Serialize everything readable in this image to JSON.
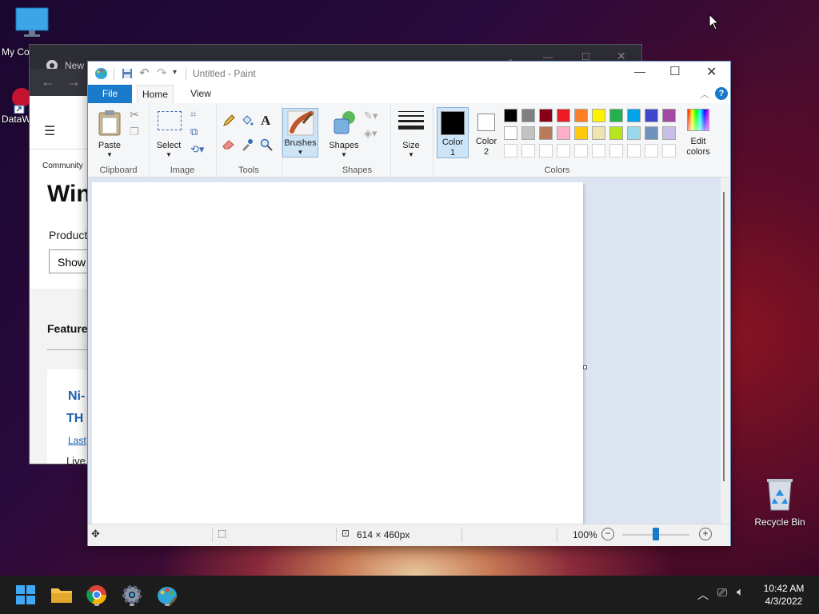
{
  "desktop": {
    "icons": [
      {
        "label": "My Co"
      },
      {
        "label": "DataW"
      },
      {
        "label": "Recycle Bin"
      }
    ]
  },
  "chrome": {
    "tab_title": "New",
    "community": "Community",
    "heading": "Win",
    "product_label": "Product",
    "show_btn": "Show",
    "featured": "Feature",
    "card_title_1": "Ni-",
    "card_title_2": "TH",
    "last_link": "Last",
    "live_text": "Live"
  },
  "paint": {
    "title": "Untitled - Paint",
    "tabs": {
      "file": "File",
      "home": "Home",
      "view": "View"
    },
    "groups": {
      "clipboard": "Clipboard",
      "image": "Image",
      "tools": "Tools",
      "shapes": "Shapes",
      "colors": "Colors"
    },
    "buttons": {
      "paste": "Paste",
      "select": "Select",
      "brushes": "Brushes",
      "shapes": "Shapes",
      "size": "Size",
      "color1_line1": "Color",
      "color1_line2": "1",
      "color2_line1": "Color",
      "color2_line2": "2",
      "edit_colors_line1": "Edit",
      "edit_colors_line2": "colors"
    },
    "palette": {
      "row1": [
        "#000000",
        "#7f7f7f",
        "#880015",
        "#ed1c24",
        "#ff7f27",
        "#fff200",
        "#22b14c",
        "#00a2e8",
        "#3f48cc",
        "#a349a4"
      ],
      "row2": [
        "#ffffff",
        "#c3c3c3",
        "#b97a57",
        "#ffaec9",
        "#ffc90e",
        "#efe4b0",
        "#b5e61d",
        "#99d9ea",
        "#7092be",
        "#c8bfe7"
      ],
      "row3": [
        "#ffffff",
        "#ffffff",
        "#ffffff",
        "#ffffff",
        "#ffffff",
        "#ffffff",
        "#ffffff",
        "#ffffff",
        "#ffffff",
        "#ffffff"
      ]
    },
    "color1": "#000000",
    "color2": "#ffffff",
    "status": {
      "canvas_size": "614 × 460px",
      "zoom": "100%"
    }
  },
  "taskbar": {
    "time": "10:42 AM",
    "date": "4/3/2022"
  }
}
